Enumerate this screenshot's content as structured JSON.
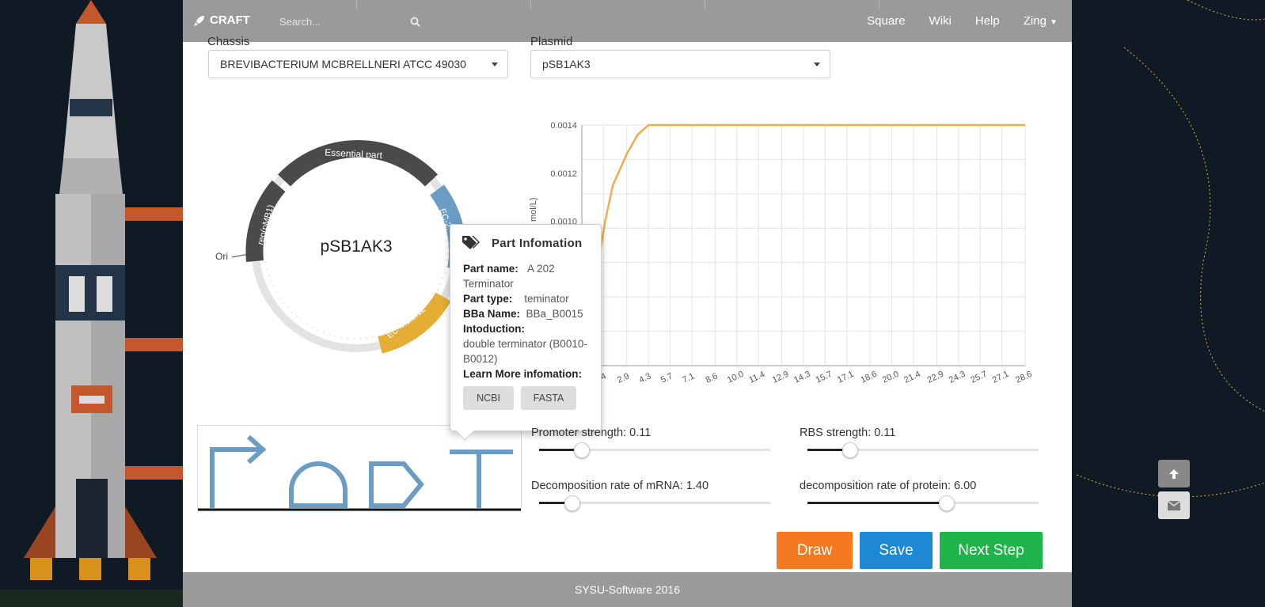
{
  "nav": {
    "brand": "CRAFT",
    "search_placeholder": "Search...",
    "links": [
      "Square",
      "Wiki",
      "Help",
      "Zing"
    ]
  },
  "form": {
    "chassis_label": "Chassis",
    "chassis_value": "BREVIBACTERIUM MCBRELLNERI ATCC 49030",
    "plasmid_label": "Plasmid",
    "plasmid_value": "pSB1AK3"
  },
  "plasmid_map": {
    "name": "pSB1AK3",
    "labels": {
      "essential": "Essential part",
      "rep": "rep(pMB1)",
      "ori": "Ori",
      "ec_top": "EC-2.",
      "ec_bottom": "EC-4.1.2.12"
    }
  },
  "popover": {
    "title": "Part Infomation",
    "part_name_label": "Part name:",
    "part_name": "A 202",
    "part_name_cont": "Terminator",
    "part_type_label": "Part type:",
    "part_type": "teminator",
    "bba_label": "BBa Name:",
    "bba": "BBa_B0015",
    "intro_label": "Intoduction:",
    "intro_1": "double terminator (B0010-",
    "intro_2": "B0012)",
    "learn_label": "Learn More infomation:",
    "ncbi": "NCBI",
    "fasta": "FASTA"
  },
  "chart_data": {
    "type": "line",
    "ylabel": "mol/L)",
    "y_ticks": [
      "0.0014",
      "0.0012",
      "0.0010"
    ],
    "ylim": [
      0.0004,
      0.0014
    ],
    "x_ticks": [
      "1.4",
      "2.9",
      "4.3",
      "5.7",
      "7.1",
      "8.6",
      "10.0",
      "11.4",
      "12.9",
      "14.3",
      "15.7",
      "17.1",
      "18.6",
      "20.0",
      "21.4",
      "22.9",
      "24.3",
      "25.7",
      "27.1",
      "28.6"
    ],
    "xlim": [
      0,
      28.6
    ],
    "series": [
      {
        "color": "#f0ad4e",
        "x": [
          0,
          1.5,
          2.0,
          2.9,
          3.6,
          4.3,
          28.6
        ],
        "y": [
          0.0004,
          0.001,
          0.00115,
          0.00128,
          0.00136,
          0.0014,
          0.0014
        ]
      }
    ]
  },
  "sliders": [
    {
      "label": "Promoter strength: 0.11",
      "value": 0.18
    },
    {
      "label": "RBS strength: 0.11",
      "value": 0.18
    },
    {
      "label": "Decomposition rate of mRNA: 1.40",
      "value": 0.14
    },
    {
      "label": "decomposition rate of protein: 6.00",
      "value": 0.6
    }
  ],
  "buttons": {
    "draw": "Draw",
    "save": "Save",
    "next": "Next Step"
  },
  "footer": "SYSU-Software 2016",
  "colors": {
    "orange": "#f47920",
    "blue": "#1e88d4",
    "green": "#1fb44a",
    "ec_blue": "#6a9cc4",
    "ec_yellow": "#e4ae35",
    "dark": "#444"
  }
}
